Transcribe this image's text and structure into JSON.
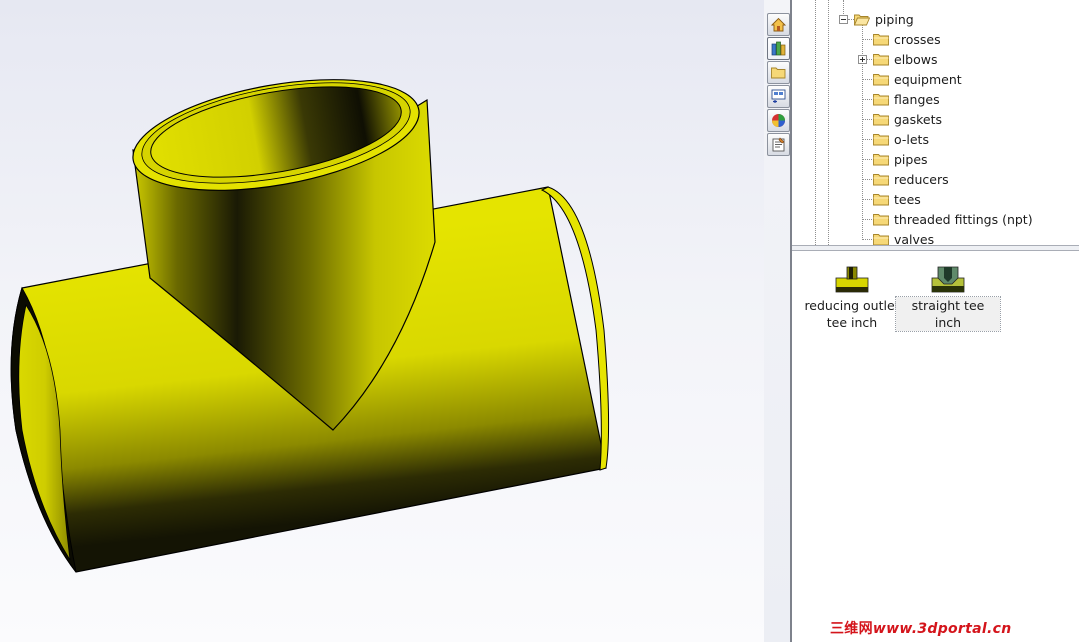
{
  "colors": {
    "model_yellow": "#e4e200",
    "model_shadow": "#151504",
    "outline": "#000000",
    "tab_border": "#8c929e",
    "folder_fill": "#f6d877",
    "folder_stroke": "#a7852a"
  },
  "viewport": {
    "model_name": "straight tee"
  },
  "task_tabs": [
    {
      "icon": "home-icon"
    },
    {
      "icon": "design-library-icon",
      "active": true
    },
    {
      "icon": "file-explorer-icon"
    },
    {
      "icon": "view-palette-icon"
    },
    {
      "icon": "appearances-icon"
    },
    {
      "icon": "custom-properties-icon"
    }
  ],
  "tree": {
    "root": {
      "label": "piping",
      "icon": "open-folder-icon",
      "expanded": true
    },
    "children": [
      {
        "label": "crosses",
        "icon": "folder-icon"
      },
      {
        "label": "elbows",
        "icon": "folder-icon",
        "has_children": true
      },
      {
        "label": "equipment",
        "icon": "folder-icon"
      },
      {
        "label": "flanges",
        "icon": "folder-icon"
      },
      {
        "label": "gaskets",
        "icon": "folder-icon"
      },
      {
        "label": "o-lets",
        "icon": "folder-icon"
      },
      {
        "label": "pipes",
        "icon": "folder-icon"
      },
      {
        "label": "reducers",
        "icon": "folder-icon"
      },
      {
        "label": "tees",
        "icon": "folder-icon"
      },
      {
        "label": "threaded fittings (npt)",
        "icon": "folder-icon"
      },
      {
        "label": "valves",
        "icon": "folder-icon"
      }
    ]
  },
  "palette": {
    "items": [
      {
        "label_line1": "reducing outlet",
        "label_line2": "tee inch",
        "icon": "reducing-tee-icon"
      },
      {
        "label_line1": "straight tee inch",
        "label_line2": "",
        "icon": "straight-tee-icon",
        "selected": true
      }
    ]
  },
  "watermark": {
    "cn": "三维网",
    "url": "www.3dportal.cn"
  }
}
